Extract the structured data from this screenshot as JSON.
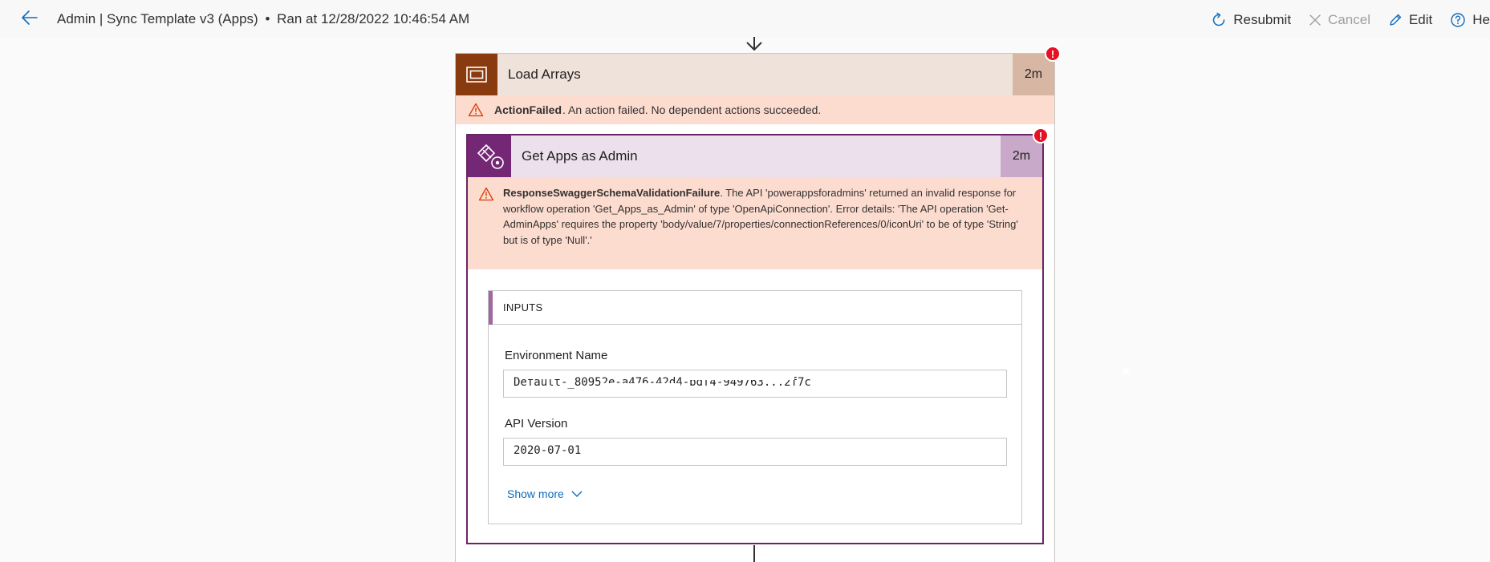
{
  "header": {
    "flow_name": "Admin | Sync Template v3 (Apps)",
    "separator": "•",
    "run_info": "Ran at 12/28/2022 10:46:54 AM",
    "actions": {
      "resubmit": "Resubmit",
      "cancel": "Cancel",
      "edit": "Edit",
      "help": "He"
    }
  },
  "scope": {
    "name": "Load Arrays",
    "duration": "2m",
    "status_badge": "!",
    "error_code": "ActionFailed",
    "error_message": ". An action failed. No dependent actions succeeded."
  },
  "action": {
    "name": "Get Apps as Admin",
    "duration": "2m",
    "status_badge": "!",
    "error_code": "ResponseSwaggerSchemaValidationFailure",
    "error_message": ". The API 'powerappsforadmins' returned an invalid response for workflow operation 'Get_Apps_as_Admin' of type 'OpenApiConnection'. Error details: 'The API operation 'Get-AdminApps' requires the property 'body/value/7/properties/connectionReferences/0/iconUri' to be of type 'String' but is of type 'Null'.'",
    "inputs": {
      "header": "INPUTS",
      "fields": [
        {
          "label": "Environment Name",
          "value": "Default-_80952e-a476-42d4-bdf4-949763...2f7c"
        },
        {
          "label": "API Version",
          "value": "2020-07-01"
        }
      ],
      "show_more": "Show more"
    }
  },
  "colors": {
    "scope_accent": "#8a3a0f",
    "action_accent": "#742774",
    "error_bg": "#fddcd0",
    "link": "#0f6cbd",
    "badge": "#e81123"
  }
}
